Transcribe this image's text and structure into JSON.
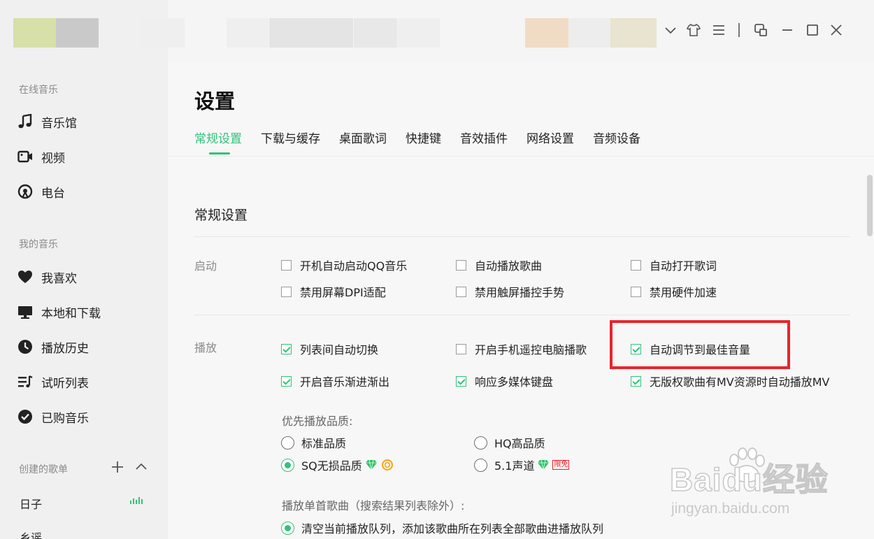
{
  "sidebar": {
    "online_label": "在线音乐",
    "online_items": [
      {
        "label": "音乐馆",
        "icon": "music-note-icon"
      },
      {
        "label": "视频",
        "icon": "video-icon"
      },
      {
        "label": "电台",
        "icon": "radio-icon"
      }
    ],
    "my_label": "我的音乐",
    "my_items": [
      {
        "label": "我喜欢",
        "icon": "heart-icon"
      },
      {
        "label": "本地和下载",
        "icon": "monitor-icon"
      },
      {
        "label": "播放历史",
        "icon": "clock-icon"
      },
      {
        "label": "试听列表",
        "icon": "playlist-icon"
      },
      {
        "label": "已购音乐",
        "icon": "check-circle-icon"
      }
    ],
    "created_label": "创建的歌单",
    "playlists": [
      "日子",
      "乡谣"
    ]
  },
  "window_controls": [
    "chevron-down-icon",
    "skin-icon",
    "menu-icon",
    "mini-mode-icon",
    "minimize-icon",
    "maximize-icon",
    "close-icon"
  ],
  "settings": {
    "title": "设置",
    "tabs": [
      "常规设置",
      "下载与缓存",
      "桌面歌词",
      "快捷键",
      "音效插件",
      "网络设置",
      "音频设备"
    ],
    "active_tab": 0,
    "section_title": "常规设置",
    "startup": {
      "label": "启动",
      "options": [
        {
          "label": "开机自动启动QQ音乐",
          "checked": false
        },
        {
          "label": "自动播放歌曲",
          "checked": false
        },
        {
          "label": "自动打开歌词",
          "checked": false
        },
        {
          "label": "禁用屏幕DPI适配",
          "checked": false
        },
        {
          "label": "禁用触屏播控手势",
          "checked": false
        },
        {
          "label": "禁用硬件加速",
          "checked": false
        }
      ]
    },
    "playback": {
      "label": "播放",
      "options": [
        {
          "label": "列表间自动切换",
          "checked": true
        },
        {
          "label": "开启手机遥控电脑播歌",
          "checked": false
        },
        {
          "label": "自动调节到最佳音量",
          "checked": true
        },
        {
          "label": "开启音乐渐进渐出",
          "checked": true
        },
        {
          "label": "响应多媒体键盘",
          "checked": true
        },
        {
          "label": "无版权歌曲有MV资源时自动播放MV",
          "checked": true
        }
      ],
      "quality_label": "优先播放品质:",
      "quality_options": [
        {
          "label": "标准品质",
          "selected": false
        },
        {
          "label": "HQ高品质",
          "selected": false
        },
        {
          "label": "SQ无损品质",
          "selected": true
        },
        {
          "label": "5.1声道",
          "selected": false
        }
      ],
      "limited_free_badge": "限免",
      "single_song_label": "播放单首歌曲（搜索结果列表除外）:",
      "single_song_options": [
        {
          "label": "清空当前播放队列，添加该歌曲所在列表全部歌曲进播放队列",
          "selected": true
        }
      ]
    }
  },
  "watermark": {
    "brand": "Baidu经验",
    "url": "jingyan.baidu.com"
  },
  "colors": {
    "accent": "#31c27c",
    "highlight": "#e8242c",
    "sidebar_bg": "#f0f0f0"
  }
}
